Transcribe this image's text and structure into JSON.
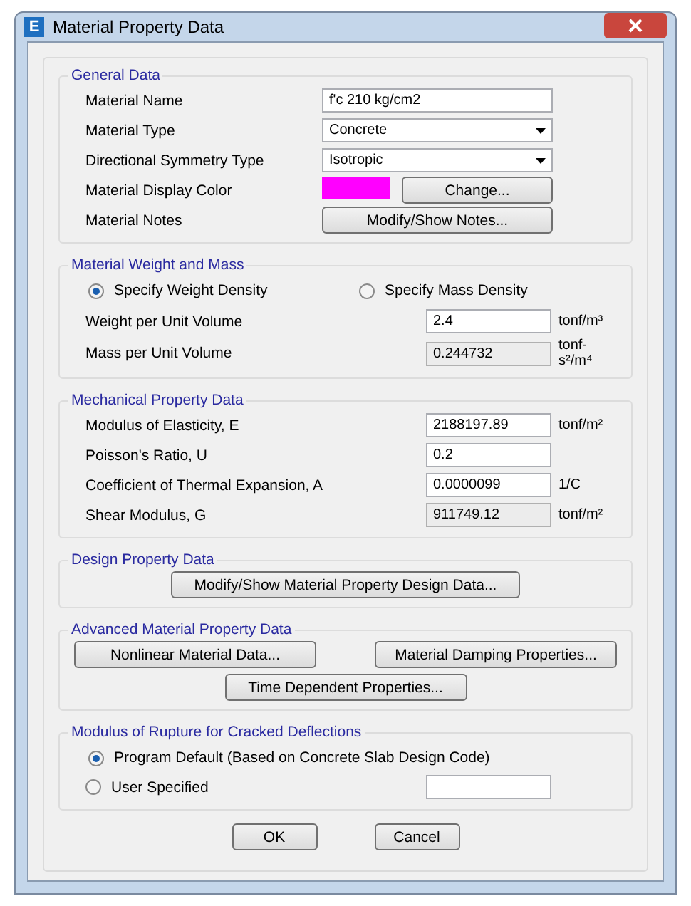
{
  "window": {
    "title": "Material Property Data",
    "app_icon": "E"
  },
  "general_data": {
    "title": "General Data",
    "rows": [
      {
        "kind": "text",
        "label": "Material Name",
        "value": "f'c 210 kg/cm2"
      },
      {
        "kind": "dropdown",
        "label": "Material Type",
        "value": "Concrete"
      },
      {
        "kind": "dropdown",
        "label": "Directional Symmetry Type",
        "value": "Isotropic"
      },
      {
        "kind": "color",
        "label": "Material Display Color",
        "color": "#ff00ff",
        "button": "Change..."
      },
      {
        "kind": "button",
        "label": "Material Notes",
        "button": "Modify/Show Notes..."
      }
    ]
  },
  "weight_and_mass": {
    "title": "Material Weight and Mass",
    "options": [
      {
        "label": "Specify Weight Density",
        "selected": true
      },
      {
        "label": "Specify Mass Density",
        "selected": false
      }
    ],
    "rows": [
      {
        "kind": "field",
        "label": "Weight per Unit Volume",
        "value": "2.4",
        "unit": "tonf/m³"
      },
      {
        "kind": "readonly",
        "label": "Mass per Unit Volume",
        "value": "0.244732",
        "unit": "tonf-s²/m⁴"
      }
    ]
  },
  "mechanical": {
    "title": "Mechanical Property Data",
    "rows": [
      {
        "kind": "field",
        "label": "Modulus of Elasticity,  E",
        "value": "2188197.89",
        "unit": "tonf/m²"
      },
      {
        "kind": "field",
        "label": "Poisson's Ratio,  U",
        "value": "0.2"
      },
      {
        "kind": "field",
        "label": "Coefficient of Thermal Expansion,  A",
        "value": "0.0000099",
        "unit": "1/C"
      },
      {
        "kind": "readonly",
        "label": "Shear Modulus,  G",
        "value": "911749.12",
        "unit": "tonf/m²"
      }
    ]
  },
  "design": {
    "title": "Design Property Data",
    "buttons": [
      "Modify/Show Material Property Design Data..."
    ]
  },
  "advanced": {
    "title": "Advanced Material Property Data",
    "buttons": [
      "Nonlinear Material Data...",
      "Material Damping Properties...",
      "Time Dependent Properties..."
    ]
  },
  "rupture": {
    "title": "Modulus of Rupture for Cracked Deflections",
    "options": [
      {
        "kind": "plain",
        "label": "Program Default  (Based on Concrete Slab Design Code)",
        "selected": true
      },
      {
        "kind": "with_field",
        "label": "User Specified",
        "selected": false
      }
    ]
  },
  "buttons": [
    "OK",
    "Cancel"
  ]
}
